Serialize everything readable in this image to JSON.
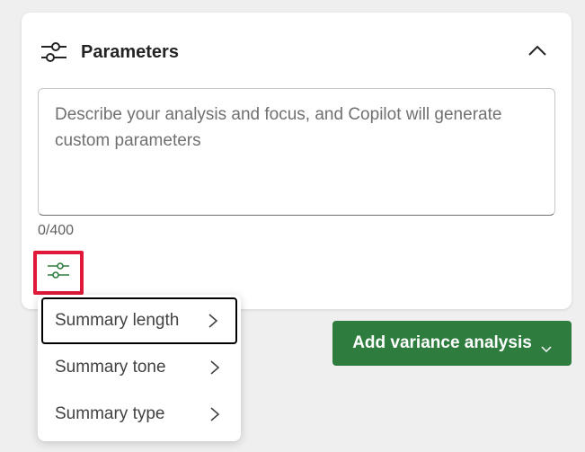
{
  "panel": {
    "title": "Parameters",
    "header_icon": "sliders-icon",
    "collapse_icon": "chevron-up-icon"
  },
  "prompt_input": {
    "value": "",
    "placeholder": "Describe your analysis and focus, and Copilot will generate custom parameters",
    "char_count": "0/400"
  },
  "settings_button": {
    "icon": "sliders-icon",
    "accent_color": "#2e7d3f",
    "highlight_color": "#e0193a"
  },
  "menu": {
    "items": [
      {
        "label": "Summary length",
        "icon": "chevron-right-icon"
      },
      {
        "label": "Summary tone",
        "icon": "chevron-right-icon"
      },
      {
        "label": "Summary type",
        "icon": "chevron-right-icon"
      }
    ]
  },
  "actions": {
    "add_variance_label": "Add variance analysis",
    "add_variance_icon": "chevron-down-icon",
    "button_color": "#2e7d3f"
  }
}
